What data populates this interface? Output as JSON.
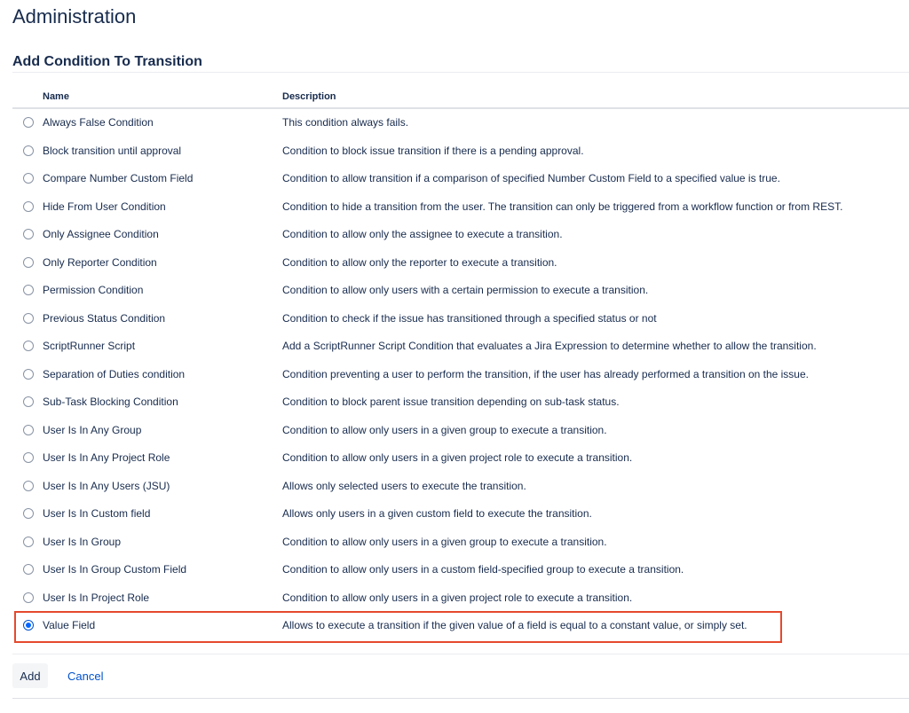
{
  "page": {
    "title": "Administration"
  },
  "section": {
    "title": "Add Condition To Transition"
  },
  "table": {
    "columns": {
      "name": "Name",
      "description": "Description"
    },
    "rows": [
      {
        "name": "Always False Condition",
        "description": "This condition always fails.",
        "selected": false
      },
      {
        "name": "Block transition until approval",
        "description": "Condition to block issue transition if there is a pending approval.",
        "selected": false
      },
      {
        "name": "Compare Number Custom Field",
        "description": "Condition to allow transition if a comparison of specified Number Custom Field to a specified value is true.",
        "selected": false
      },
      {
        "name": "Hide From User Condition",
        "description": "Condition to hide a transition from the user. The transition can only be triggered from a workflow function or from REST.",
        "selected": false
      },
      {
        "name": "Only Assignee Condition",
        "description": "Condition to allow only the assignee to execute a transition.",
        "selected": false
      },
      {
        "name": "Only Reporter Condition",
        "description": "Condition to allow only the reporter to execute a transition.",
        "selected": false
      },
      {
        "name": "Permission Condition",
        "description": "Condition to allow only users with a certain permission to execute a transition.",
        "selected": false
      },
      {
        "name": "Previous Status Condition",
        "description": "Condition to check if the issue has transitioned through a specified status or not",
        "selected": false
      },
      {
        "name": "ScriptRunner Script",
        "description": "Add a ScriptRunner Script Condition that evaluates a Jira Expression to determine whether to allow the transition.",
        "selected": false
      },
      {
        "name": "Separation of Duties condition",
        "description": "Condition preventing a user to perform the transition, if the user has already performed a transition on the issue.",
        "selected": false
      },
      {
        "name": "Sub-Task Blocking Condition",
        "description": "Condition to block parent issue transition depending on sub-task status.",
        "selected": false
      },
      {
        "name": "User Is In Any Group",
        "description": "Condition to allow only users in a given group to execute a transition.",
        "selected": false
      },
      {
        "name": "User Is In Any Project Role",
        "description": "Condition to allow only users in a given project role to execute a transition.",
        "selected": false
      },
      {
        "name": "User Is In Any Users (JSU)",
        "description": "Allows only selected users to execute the transition.",
        "selected": false
      },
      {
        "name": "User Is In Custom field",
        "description": "Allows only users in a given custom field to execute the transition.",
        "selected": false
      },
      {
        "name": "User Is In Group",
        "description": "Condition to allow only users in a given group to execute a transition.",
        "selected": false
      },
      {
        "name": "User Is In Group Custom Field",
        "description": "Condition to allow only users in a custom field-specified group to execute a transition.",
        "selected": false
      },
      {
        "name": "User Is In Project Role",
        "description": "Condition to allow only users in a given project role to execute a transition.",
        "selected": false
      },
      {
        "name": "Value Field",
        "description": "Allows to execute a transition if the given value of a field is equal to a constant value, or simply set.",
        "selected": true
      }
    ]
  },
  "actions": {
    "add_label": "Add",
    "cancel_label": "Cancel"
  },
  "colors": {
    "highlight": "#e5492d",
    "accent": "#0052cc",
    "text": "#172b4d"
  }
}
